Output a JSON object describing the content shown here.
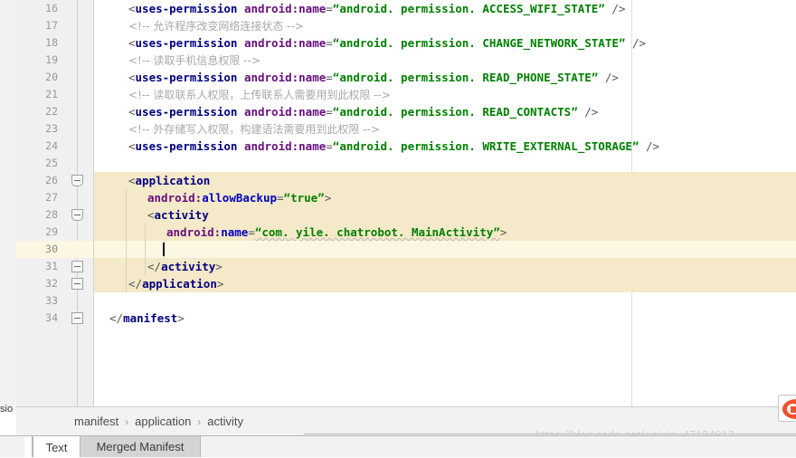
{
  "window": {
    "left_strip_label": "sio"
  },
  "editor": {
    "first_line": 16,
    "cursor_line": 30,
    "lines": [
      {
        "num": 16,
        "type": "code",
        "indent": 1,
        "segments": [
          {
            "t": "<",
            "c": "punct"
          },
          {
            "t": "uses-permission",
            "c": "tagname"
          },
          {
            "t": " ",
            "c": "plain"
          },
          {
            "t": "android:name",
            "c": "attr"
          },
          {
            "t": "=",
            "c": "punct"
          },
          {
            "t": "“android. permission. ACCESS_WIFI_STATE”",
            "c": "str"
          },
          {
            "t": " ",
            "c": "plain"
          },
          {
            "t": "/>",
            "c": "punct"
          }
        ]
      },
      {
        "num": 17,
        "type": "comment",
        "indent": 1,
        "text": "<!-- 允许程序改变网络连接状态 -->"
      },
      {
        "num": 18,
        "type": "code",
        "indent": 1,
        "segments": [
          {
            "t": "<",
            "c": "punct"
          },
          {
            "t": "uses-permission",
            "c": "tagname"
          },
          {
            "t": " ",
            "c": "plain"
          },
          {
            "t": "android:name",
            "c": "attr"
          },
          {
            "t": "=",
            "c": "punct"
          },
          {
            "t": "“android. permission. CHANGE_NETWORK_STATE”",
            "c": "str"
          },
          {
            "t": " ",
            "c": "plain"
          },
          {
            "t": "/>",
            "c": "punct"
          }
        ]
      },
      {
        "num": 19,
        "type": "comment",
        "indent": 1,
        "text": "<!-- 读取手机信息权限 -->"
      },
      {
        "num": 20,
        "type": "code",
        "indent": 1,
        "segments": [
          {
            "t": "<",
            "c": "punct"
          },
          {
            "t": "uses-permission",
            "c": "tagname"
          },
          {
            "t": " ",
            "c": "plain"
          },
          {
            "t": "android:name",
            "c": "attr"
          },
          {
            "t": "=",
            "c": "punct"
          },
          {
            "t": "“android. permission. READ_PHONE_STATE”",
            "c": "str"
          },
          {
            "t": " ",
            "c": "plain"
          },
          {
            "t": "/>",
            "c": "punct"
          }
        ]
      },
      {
        "num": 21,
        "type": "comment",
        "indent": 1,
        "text": "<!-- 读取联系人权限，上传联系人需要用到此权限 -->"
      },
      {
        "num": 22,
        "type": "code",
        "indent": 1,
        "segments": [
          {
            "t": "<",
            "c": "punct"
          },
          {
            "t": "uses-permission",
            "c": "tagname"
          },
          {
            "t": " ",
            "c": "plain"
          },
          {
            "t": "android:name",
            "c": "attr"
          },
          {
            "t": "=",
            "c": "punct"
          },
          {
            "t": "“android. permission. READ_CONTACTS”",
            "c": "str"
          },
          {
            "t": " ",
            "c": "plain"
          },
          {
            "t": "/>",
            "c": "punct"
          }
        ]
      },
      {
        "num": 23,
        "type": "comment",
        "indent": 1,
        "text": "<!-- 外存储写入权限，构建语法需要用到此权限 -->"
      },
      {
        "num": 24,
        "type": "code",
        "indent": 1,
        "segments": [
          {
            "t": "<",
            "c": "punct"
          },
          {
            "t": "uses-permission",
            "c": "tagname"
          },
          {
            "t": " ",
            "c": "plain"
          },
          {
            "t": "android:name",
            "c": "attr"
          },
          {
            "t": "=",
            "c": "punct"
          },
          {
            "t": "“android. permission. WRITE_EXTERNAL_STORAGE”",
            "c": "str"
          },
          {
            "t": " ",
            "c": "plain"
          },
          {
            "t": "/>",
            "c": "punct"
          }
        ]
      },
      {
        "num": 25,
        "type": "blank",
        "indent": 0,
        "segments": []
      },
      {
        "num": 26,
        "type": "code",
        "indent": 1,
        "segments": [
          {
            "t": "<",
            "c": "punct"
          },
          {
            "t": "application",
            "c": "tagname"
          }
        ]
      },
      {
        "num": 27,
        "type": "code",
        "indent": 2,
        "segments": [
          {
            "t": "android:",
            "c": "attr"
          },
          {
            "t": "allowBackup",
            "c": "attrname2"
          },
          {
            "t": "=",
            "c": "punct"
          },
          {
            "t": "“true”",
            "c": "str"
          },
          {
            "t": ">",
            "c": "punct"
          }
        ]
      },
      {
        "num": 28,
        "type": "code",
        "indent": 2,
        "segments": [
          {
            "t": "<",
            "c": "punct"
          },
          {
            "t": "activity",
            "c": "tagname"
          }
        ]
      },
      {
        "num": 29,
        "type": "code",
        "indent": 3,
        "segments": [
          {
            "t": "android:",
            "c": "attr"
          },
          {
            "t": "name",
            "c": "attrname2"
          },
          {
            "t": "=",
            "c": "punct"
          },
          {
            "t": "“com. yile. chatrobot. MainActivity”",
            "c": "str squiggle"
          },
          {
            "t": ">",
            "c": "punct"
          }
        ]
      },
      {
        "num": 30,
        "type": "blank",
        "indent": 3,
        "segments": []
      },
      {
        "num": 31,
        "type": "code",
        "indent": 2,
        "segments": [
          {
            "t": "</",
            "c": "punct"
          },
          {
            "t": "activity",
            "c": "tagname"
          },
          {
            "t": ">",
            "c": "punct"
          }
        ]
      },
      {
        "num": 32,
        "type": "code",
        "indent": 1,
        "segments": [
          {
            "t": "</",
            "c": "punct"
          },
          {
            "t": "application",
            "c": "tagname"
          },
          {
            "t": ">",
            "c": "punct"
          }
        ]
      },
      {
        "num": 33,
        "type": "blank",
        "indent": 0,
        "segments": []
      },
      {
        "num": 34,
        "type": "code",
        "indent": 0,
        "segments": [
          {
            "t": "</",
            "c": "punct"
          },
          {
            "t": "manifest",
            "c": "tagname"
          },
          {
            "t": ">",
            "c": "punct"
          }
        ]
      }
    ],
    "fold_markers": [
      26,
      28,
      31,
      32,
      34
    ],
    "highlight_color": "#f4e9c8",
    "current_line_color": "#fcf7e3"
  },
  "breadcrumb": {
    "items": [
      "manifest",
      "application",
      "activity"
    ],
    "separator": "›"
  },
  "tabs": [
    {
      "label": "Text",
      "selected": true
    },
    {
      "label": "Merged Manifest",
      "selected": false
    }
  ],
  "watermark": {
    "text": "https://blog.csdn.net/weixin_47124812"
  },
  "corner_icon": {
    "name": "app-badge-icon",
    "color": "#f4502a"
  }
}
